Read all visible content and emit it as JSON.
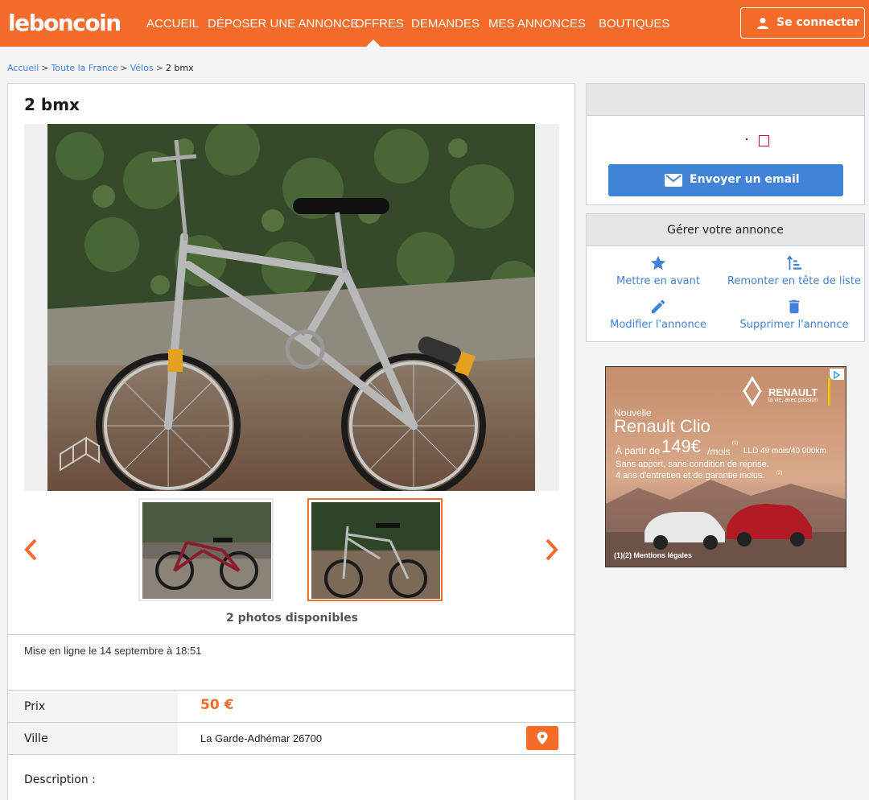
{
  "header": {
    "logo": "leboncoin",
    "nav": [
      "ACCUEIL",
      "DÉPOSER UNE ANNONCE",
      "OFFRES",
      "DEMANDES",
      "MES ANNONCES",
      "BOUTIQUES"
    ],
    "active_nav": "OFFRES",
    "login_label": "Se connecter",
    "brand_color": "#f56b2a"
  },
  "breadcrumb": {
    "items": [
      "Accueil",
      "Toute la France",
      "Vélos"
    ],
    "current": "2 bmx"
  },
  "listing": {
    "title": "2 bmx",
    "photos_count": "2 photos disponibles",
    "posted": "Mise en ligne le 14 septembre à 18:51",
    "price_label": "Prix",
    "price": "50 €",
    "city_label": "Ville",
    "city": "La Garde-Adhémar 26700",
    "description_label": "Description :"
  },
  "contact": {
    "email_label": "Envoyer un email"
  },
  "manage": {
    "title": "Gérer votre annonce",
    "actions": [
      {
        "label": "Mettre en avant",
        "icon": "star-icon"
      },
      {
        "label": "Remonter en tête de liste",
        "icon": "sort-up-icon"
      },
      {
        "label": "Modifier l'annonce",
        "icon": "pencil-icon"
      },
      {
        "label": "Supprimer l'annonce",
        "icon": "trash-icon"
      }
    ]
  },
  "ad": {
    "brand": "RENAULT",
    "tagline": "la vie, avec passion",
    "line1": "Nouvelle",
    "model": "Renault Clio",
    "price_prefix": "À partir de",
    "price": "149€",
    "price_suffix": "/mois",
    "footnote_mark": "(1)",
    "lld": "LLD 49 mois/40 000km",
    "line3": "Sans apport, sans condition de reprise.",
    "line4": "4 ans d'entretien et de garantie inclus.",
    "footnote_mark2": "(2)",
    "legal": "(1)(2) Mentions légales"
  }
}
